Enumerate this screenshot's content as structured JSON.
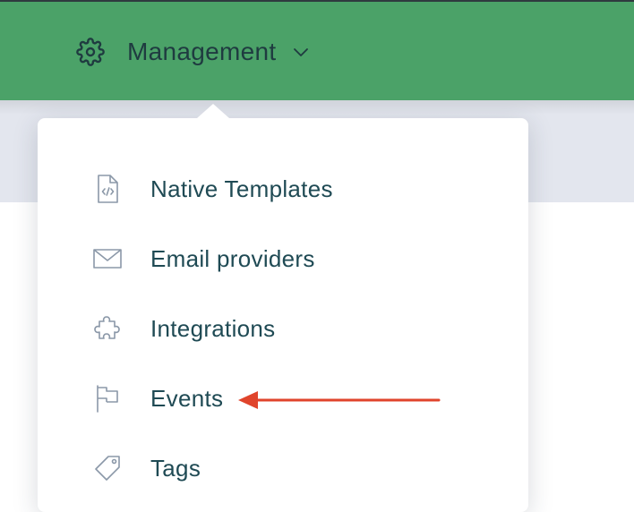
{
  "header": {
    "menu_label": "Management",
    "icon": "gear-icon",
    "chevron": "chevron-down-icon",
    "background_color": "#4ba268"
  },
  "dropdown": {
    "items": [
      {
        "label": "Native Templates",
        "icon": "code-file-icon"
      },
      {
        "label": "Email providers",
        "icon": "envelope-icon"
      },
      {
        "label": "Integrations",
        "icon": "puzzle-piece-icon"
      },
      {
        "label": "Events",
        "icon": "flag-icon"
      },
      {
        "label": "Tags",
        "icon": "tag-icon"
      }
    ]
  },
  "annotation": {
    "type": "arrow",
    "points_to": "Events",
    "color": "#e0442c"
  }
}
